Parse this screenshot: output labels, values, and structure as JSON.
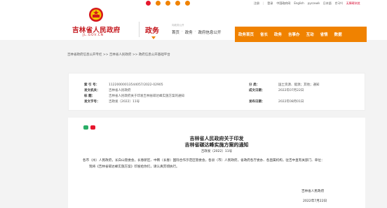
{
  "top_bar": {
    "icons": [
      {
        "name": "weibo-icon",
        "color": "#e6162d"
      },
      {
        "name": "wechat-icon",
        "color": "#f08200"
      },
      {
        "name": "app-icon",
        "color": "#f08200"
      },
      {
        "name": "accessibility-icon",
        "color": "#f08200"
      },
      {
        "name": "elder-mode-icon",
        "color": "#f08200"
      }
    ],
    "links": {
      "register": "注册",
      "login": "登录",
      "traditional": "中国政府网",
      "english": "English",
      "russian": "русский",
      "japanese": "日本語",
      "korean": "한국어",
      "barrier_free": "无障碍浏览"
    }
  },
  "header": {
    "site_title": "吉林省人民政府",
    "site_domain": "JL.GOV.CN",
    "section_title": "政务",
    "section_tag": "向政务公开",
    "subnav": [
      "首页",
      "政务",
      "政府信息公开"
    ],
    "nav": [
      "政务首页",
      "省长",
      "政务",
      "吉事办",
      "互动",
      "省情",
      "数据"
    ]
  },
  "colors": {
    "brand_red": "#c4161c",
    "nav_orange": "#f08200"
  },
  "breadcrumb": "吉林省政府信息公开专栏 >> 吉林省人民政府 >> 政府信息公开基础平台",
  "meta": {
    "index_label": "索 引 号：",
    "index_value": "11220000013544057/2022-02905",
    "category_label": "分        类：",
    "category_value": "国土资源、能源；其他；通知",
    "issuer_label": "发文机关：",
    "issuer_value": "吉林省人民政府",
    "created_label": "成文日期：",
    "created_value": "2022年07月22日",
    "title_label": "标        题：",
    "title_value": "吉林省人民政府关于印发吉林省碳达峰实施方案的通知",
    "docno_label": "发文字号：",
    "docno_value": "吉政发〔2022〕11号",
    "published_label": "发布日期：",
    "published_value": "2022年08月01日"
  },
  "article": {
    "title_line1": "吉林省人民政府关于印发",
    "title_line2": "吉林省碳达峰实施方案的通知",
    "doc_number": "吉政发〔2022〕11号",
    "recipients": "各市（州）人民政府，长白山管委会，长春新区、中韩（长春）国际合作示范区管委会，各县（市）人民政府，省政府各厅委办、各直属机构，驻吉中直有关部门、单位：",
    "body": "现将《吉林省碳达峰实施方案》印发给你们，请认真贯彻执行。",
    "signatory": "吉林省人民政府",
    "sign_date": "2022年7月22日"
  }
}
